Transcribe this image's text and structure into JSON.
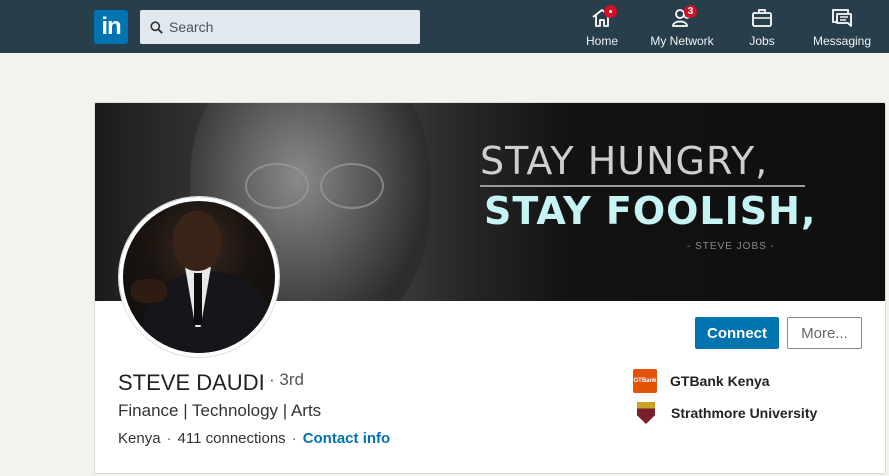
{
  "nav": {
    "logo": "in",
    "search_placeholder": "Search",
    "items": [
      {
        "label": "Home",
        "badge": ""
      },
      {
        "label": "My Network",
        "badge": "3"
      },
      {
        "label": "Jobs",
        "badge": ""
      },
      {
        "label": "Messaging",
        "badge": ""
      }
    ]
  },
  "banner": {
    "line1": "STAY HUNGRY,",
    "line2": "STAY FOOLISH,",
    "line3": "- STEVE JOBS -"
  },
  "profile": {
    "name": "STEVE DAUDI",
    "degree": "· 3rd",
    "headline": "Finance | Technology | Arts",
    "location": "Kenya",
    "connections": "411 connections",
    "contact_link": "Contact info",
    "connect_label": "Connect",
    "more_label": "More..."
  },
  "orgs": [
    {
      "logo_text": "GTBank",
      "name": "GTBank Kenya"
    },
    {
      "logo_text": "",
      "name": "Strathmore University"
    }
  ],
  "colors": {
    "nav_bg": "#283e4a",
    "brand_blue": "#0073b1",
    "badge_red": "#d11124"
  }
}
